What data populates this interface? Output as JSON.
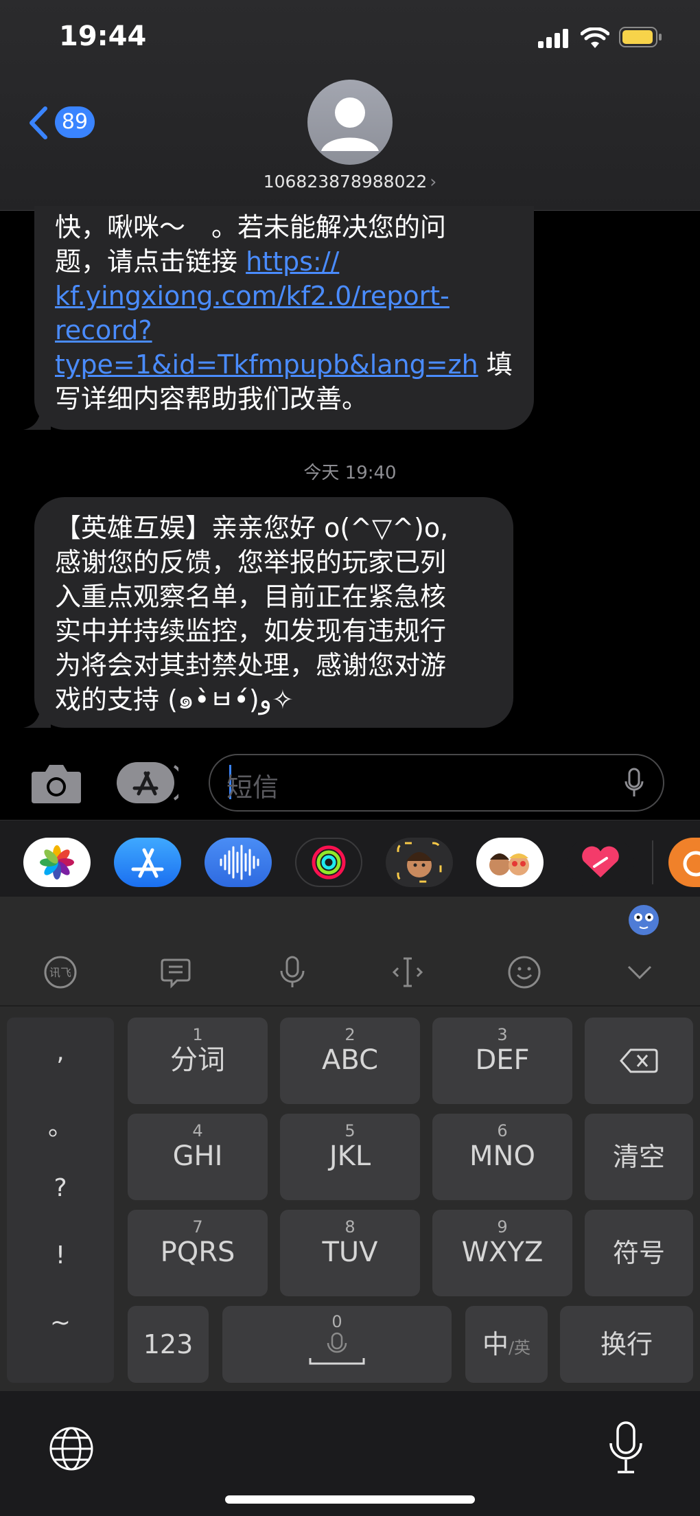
{
  "status_bar": {
    "time": "19:44"
  },
  "header": {
    "back_count": "89",
    "contact_number": "106823878988022",
    "chevron": "›"
  },
  "messages": {
    "m1": {
      "line1": "快，啾咪～　。若未能解决您的问",
      "line2_prefix": "题，请点击链接 ",
      "link_part1": "https://",
      "link_part2": "kf.yingxiong.com/kf2.0/report-",
      "link_part3": "record?",
      "link_part4": "type=1&id=Tkfmpupb&lang=zh",
      "after_link": " 填",
      "line6": "写详细内容帮助我们改善。"
    },
    "timestamp": "今天 19:40",
    "m2": {
      "line1": "【英雄互娱】亲亲您好 o(^▽^)o,",
      "line2": "感谢您的反馈，您举报的玩家已列",
      "line3": "入重点观察名单，目前正在紧急核",
      "line4": "实中并持续监控，如发现有违规行",
      "line5": "为将会对其封禁处理，感谢您对游",
      "line6": "戏的支持 (๑•̀ㅂ•́)و✧"
    }
  },
  "input": {
    "placeholder": "短信"
  },
  "app_drawer": [
    "photos-icon",
    "app-store-icon",
    "audio-message-icon",
    "activity-icon",
    "memoji-icon",
    "memoji-stickers-icon",
    "digital-touch-icon",
    "weibo-icon"
  ],
  "keyboard": {
    "toolbar": [
      "xunfei-logo-icon",
      "clipboard-icon",
      "voice-icon",
      "cursor-icon",
      "emoji-icon",
      "collapse-icon"
    ],
    "punct": [
      ",",
      "。",
      "?",
      "!",
      "~"
    ],
    "keys": [
      {
        "num": "1",
        "label": "分词"
      },
      {
        "num": "2",
        "label": "ABC"
      },
      {
        "num": "3",
        "label": "DEF"
      },
      {
        "num": "4",
        "label": "GHI"
      },
      {
        "num": "5",
        "label": "JKL"
      },
      {
        "num": "6",
        "label": "MNO"
      },
      {
        "num": "7",
        "label": "PQRS"
      },
      {
        "num": "8",
        "label": "TUV"
      },
      {
        "num": "9",
        "label": "WXYZ"
      }
    ],
    "clear": "清空",
    "symbols": "符号",
    "num_key": "123",
    "space_num": "0",
    "lang_main": "中",
    "lang_sub": "/英",
    "enter": "换行"
  }
}
